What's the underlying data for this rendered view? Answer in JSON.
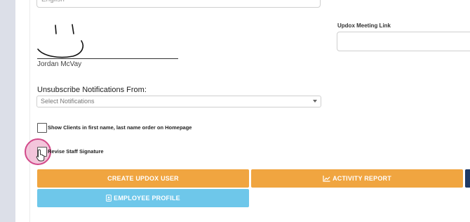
{
  "language_field": {
    "value": "English"
  },
  "signature": {
    "name": "Jordan McVay"
  },
  "updox_meeting_link": {
    "label": "Updox Meeting Link",
    "value": ""
  },
  "unsubscribe": {
    "label": "Unsubscribe Notifications From:",
    "placeholder": "Select Notifications"
  },
  "checkboxes": {
    "show_clients_first_last": "Show Clients in first name, last name order on Homepage",
    "revise_staff_signature": "Revise Staff Signature"
  },
  "buttons": {
    "create_updox_user": "CREATE UPDOX USER",
    "activity_report": "ACTIVITY REPORT",
    "employee_profile": "EMPLOYEE PROFILE"
  },
  "icons": {
    "activity_report": "line-chart-icon",
    "employee_profile": "id-badge-icon",
    "signature": "signature-drawing",
    "select_caret": "caret-down-icon"
  },
  "colors": {
    "orange_button": "#f0a540",
    "blue_button": "#6ec7ea",
    "dark_button": "#1f3a66",
    "cursor_highlight": "#d24a8a"
  }
}
